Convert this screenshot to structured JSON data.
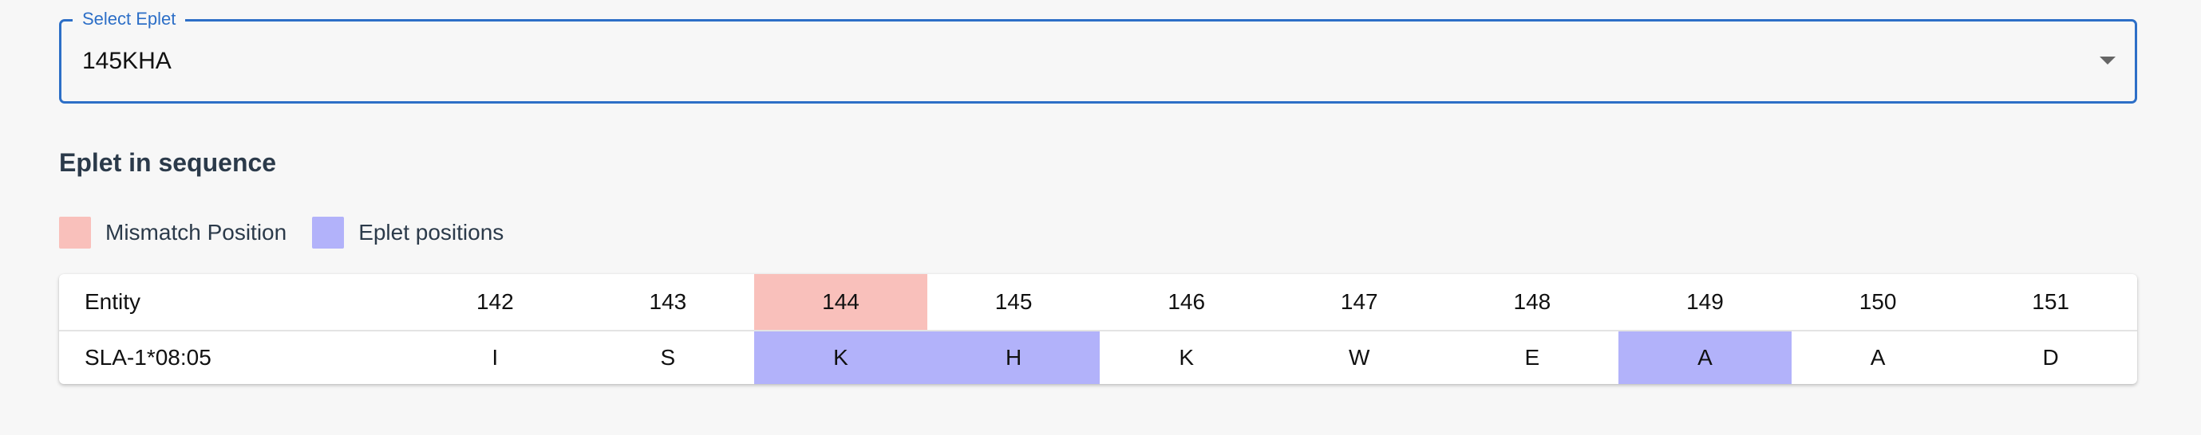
{
  "select": {
    "label": "Select Eplet",
    "value": "145KHA",
    "icon": "chevron-down-icon"
  },
  "section": {
    "title": "Eplet in sequence"
  },
  "legend": {
    "mismatch_label": "Mismatch Position",
    "eplet_label": "Eplet positions"
  },
  "colors": {
    "accent": "#2d6fc7",
    "mismatch": "#f9c0bb",
    "eplet": "#b2b2fa"
  },
  "table": {
    "header_label": "Entity",
    "positions": [
      "142",
      "143",
      "144",
      "145",
      "146",
      "147",
      "148",
      "149",
      "150",
      "151"
    ],
    "row_label": "SLA-1*08:05",
    "residues": [
      "I",
      "S",
      "K",
      "H",
      "K",
      "W",
      "E",
      "A",
      "A",
      "D"
    ],
    "mismatch_positions": [
      "144"
    ],
    "eplet_positions": [
      "144",
      "145",
      "149"
    ]
  }
}
